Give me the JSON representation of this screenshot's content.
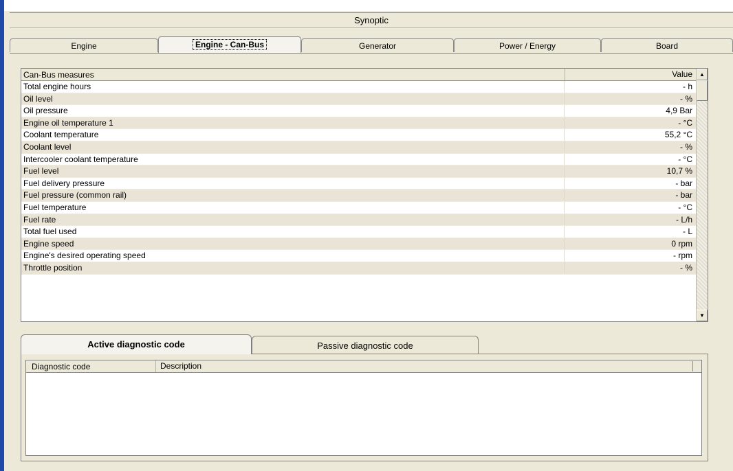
{
  "window": {
    "title": "Synoptic"
  },
  "tabs": [
    {
      "label": "Engine"
    },
    {
      "label": "Engine - Can-Bus",
      "active": true
    },
    {
      "label": "Generator"
    },
    {
      "label": "Power / Energy"
    },
    {
      "label": "Board"
    }
  ],
  "measures": {
    "headers": {
      "name": "Can-Bus measures",
      "value": "Value"
    },
    "rows": [
      {
        "name": "Total engine hours",
        "value": "- h"
      },
      {
        "name": "Oil level",
        "value": "- %"
      },
      {
        "name": "Oil pressure",
        "value": "4,9 Bar"
      },
      {
        "name": "Engine oil temperature 1",
        "value": "- °C"
      },
      {
        "name": "Coolant temperature",
        "value": "55,2 °C"
      },
      {
        "name": "Coolant level",
        "value": "- %"
      },
      {
        "name": "Intercooler coolant temperature",
        "value": "- °C"
      },
      {
        "name": "Fuel level",
        "value": "10,7 %"
      },
      {
        "name": "Fuel delivery pressure",
        "value": "- bar"
      },
      {
        "name": "Fuel pressure (common rail)",
        "value": "- bar"
      },
      {
        "name": "Fuel temperature",
        "value": "- °C"
      },
      {
        "name": "Fuel rate",
        "value": "- L/h"
      },
      {
        "name": "Total fuel used",
        "value": "- L"
      },
      {
        "name": "Engine speed",
        "value": "0 rpm"
      },
      {
        "name": "Engine's desired operating speed",
        "value": "- rpm"
      },
      {
        "name": "Throttle position",
        "value": "- %"
      }
    ]
  },
  "diagnostic": {
    "tabs": [
      {
        "label": "Active diagnostic code",
        "active": true
      },
      {
        "label": "Passive diagnostic code"
      }
    ],
    "columns": {
      "code": "Diagnostic code",
      "description": "Description"
    }
  },
  "colors": {
    "window_bg": "#ece9d8",
    "accent_left_bar": "#1f4aa8",
    "alt_row": "#e9e4d6"
  },
  "icons": {
    "scroll_up": "scroll-up-arrow-icon",
    "scroll_down": "scroll-down-arrow-icon"
  }
}
